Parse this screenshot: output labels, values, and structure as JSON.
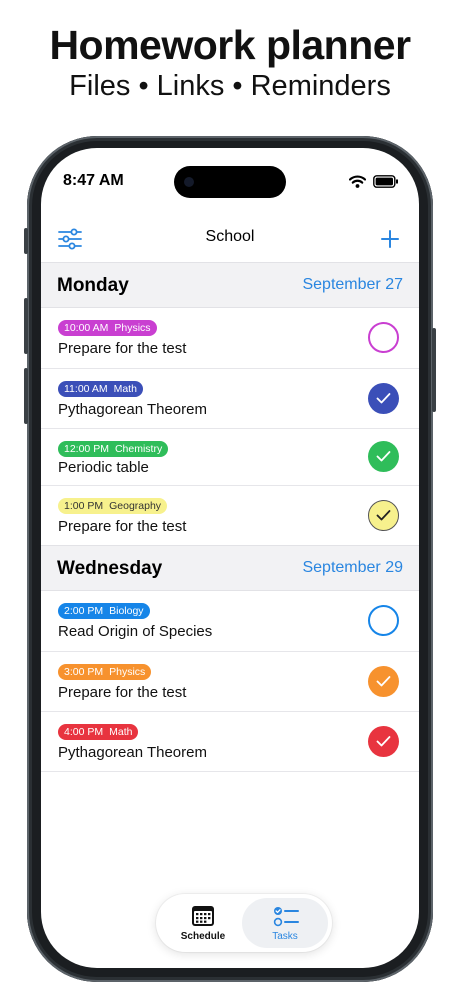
{
  "promo": {
    "headline": "Homework planner",
    "subheadline": "Files • Links • Reminders"
  },
  "status_bar": {
    "time": "8:47 AM"
  },
  "nav": {
    "title": "School",
    "filter_icon": "sliders-icon",
    "add_icon": "plus-icon"
  },
  "accent_color": "#2a86e0",
  "sections": [
    {
      "day": "Monday",
      "date": "September 27",
      "tasks": [
        {
          "time": "10:00 AM",
          "subject": "Physics",
          "title": "Prepare for the test",
          "color": "#c93fd1",
          "text_color": "#ffffff",
          "done": false
        },
        {
          "time": "11:00 AM",
          "subject": "Math",
          "title": "Pythagorean Theorem",
          "color": "#3b4fb8",
          "text_color": "#ffffff",
          "done": true
        },
        {
          "time": "12:00 PM",
          "subject": "Chemistry",
          "title": "Periodic table",
          "color": "#2fbd5a",
          "text_color": "#ffffff",
          "done": true
        },
        {
          "time": "1:00 PM",
          "subject": "Geography",
          "title": "Prepare for the test",
          "color": "#f7f18d",
          "text_color": "#333333",
          "done": true
        }
      ]
    },
    {
      "day": "Wednesday",
      "date": "September 29",
      "tasks": [
        {
          "time": "2:00 PM",
          "subject": "Biology",
          "title": "Read Origin of Species",
          "color": "#1685e8",
          "text_color": "#ffffff",
          "done": false
        },
        {
          "time": "3:00 PM",
          "subject": "Physics",
          "title": "Prepare for the test",
          "color": "#f7922e",
          "text_color": "#ffffff",
          "done": true
        },
        {
          "time": "4:00 PM",
          "subject": "Math",
          "title": "Pythagorean Theorem",
          "color": "#e8343f",
          "text_color": "#ffffff",
          "done": true
        }
      ]
    }
  ],
  "tabs": [
    {
      "label": "Schedule",
      "icon": "calendar-grid-icon",
      "active": false
    },
    {
      "label": "Tasks",
      "icon": "checklist-icon",
      "active": true
    }
  ]
}
